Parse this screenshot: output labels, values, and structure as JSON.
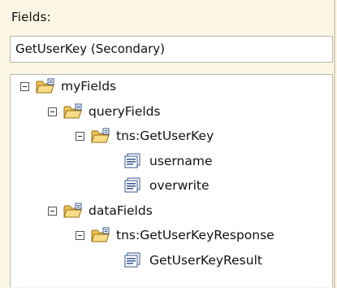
{
  "fields_label": "Fields:",
  "data_source": "GetUserKey (Secondary)",
  "tree": {
    "my_fields": "myFields",
    "query_fields": "queryFields",
    "tns_get_user_key": "tns:GetUserKey",
    "username": "username",
    "overwrite": "overwrite",
    "data_fields": "dataFields",
    "tns_get_user_key_response": "tns:GetUserKeyResponse",
    "get_user_key_result": "GetUserKeyResult"
  }
}
